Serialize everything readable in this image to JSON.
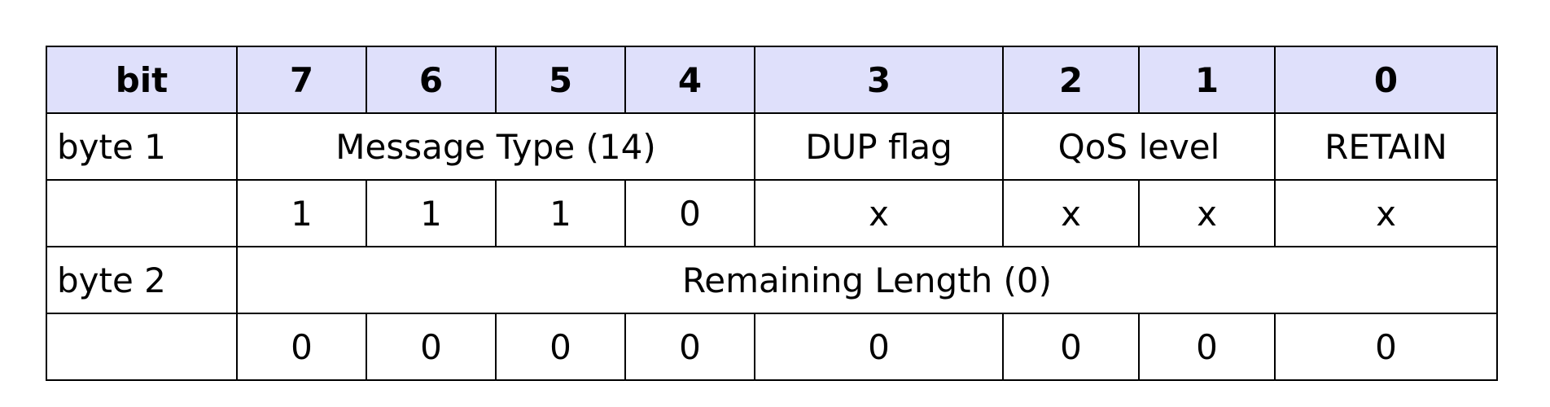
{
  "table": {
    "header": {
      "first_cell": "bit",
      "bits": [
        "7",
        "6",
        "5",
        "4",
        "3",
        "2",
        "1",
        "0"
      ]
    },
    "byte1": {
      "label": "byte 1",
      "message_type": "Message Type (14)",
      "dup_flag": "DUP flag",
      "qos_level": "QoS level",
      "retain": "RETAIN",
      "values": [
        "1",
        "1",
        "1",
        "0",
        "x",
        "x",
        "x",
        "x"
      ]
    },
    "byte2": {
      "label": "byte 2",
      "remaining_length": "Remaining Length (0)",
      "values": [
        "0",
        "0",
        "0",
        "0",
        "0",
        "0",
        "0",
        "0"
      ]
    }
  },
  "colors": {
    "header_background": "#dfe0fb",
    "border": "#000000"
  }
}
